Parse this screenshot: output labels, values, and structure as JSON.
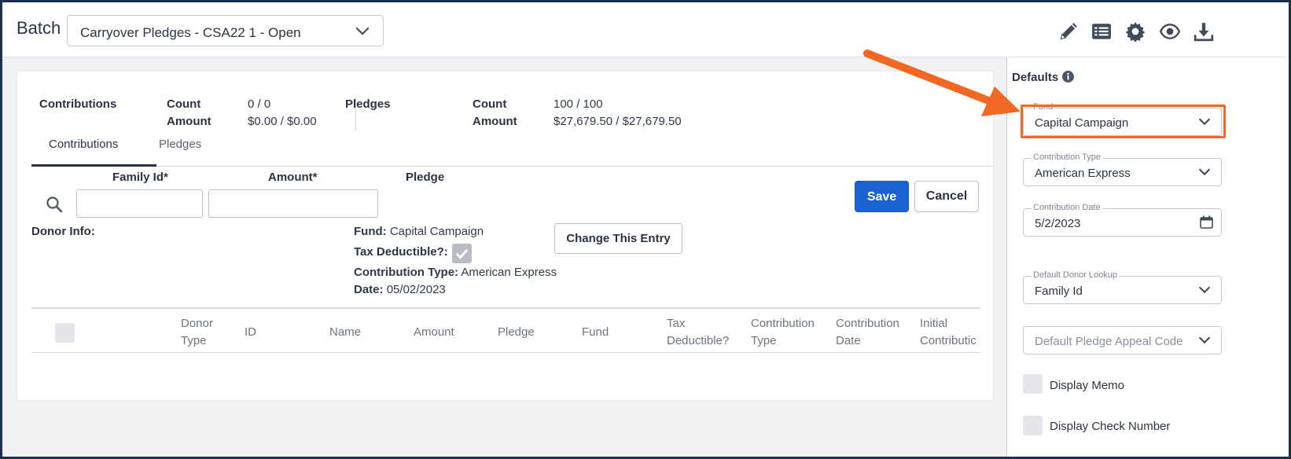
{
  "header": {
    "batch_label": "Batch",
    "batch_select_value": "Carryover Pledges - CSA22 1 - Open",
    "icons": [
      "edit-icon",
      "list-icon",
      "settings-icon",
      "eye-icon",
      "download-icon"
    ]
  },
  "summary": {
    "contributions_label": "Contributions",
    "count_label": "Count",
    "amount_label": "Amount",
    "contributions_count": "0 / 0",
    "contributions_amount": "$0.00 / $0.00",
    "pledges_label": "Pledges",
    "pledges_count": "100 / 100",
    "pledges_amount": "$27,679.50 / $27,679.50"
  },
  "tabs": [
    {
      "label": "Contributions",
      "active": true
    },
    {
      "label": "Pledges",
      "active": false
    }
  ],
  "entry": {
    "family_id_label": "Family Id*",
    "amount_label": "Amount*",
    "pledge_label": "Pledge",
    "save_label": "Save",
    "cancel_label": "Cancel",
    "donor_info_label": "Donor Info:",
    "fund_label": "Fund:",
    "fund_value": "Capital Campaign",
    "tax_deductible_label": "Tax Deductible?:",
    "contribution_type_label": "Contribution Type:",
    "contribution_type_value": "American Express",
    "date_label": "Date:",
    "date_value": "05/02/2023",
    "change_entry_label": "Change This Entry"
  },
  "grid": {
    "columns": [
      {
        "line1": "Donor",
        "line2": "Type"
      },
      {
        "line1": "ID",
        "line2": ""
      },
      {
        "line1": "Name",
        "line2": ""
      },
      {
        "line1": "Amount",
        "line2": ""
      },
      {
        "line1": "Pledge",
        "line2": ""
      },
      {
        "line1": "Fund",
        "line2": ""
      },
      {
        "line1": "Tax",
        "line2": "Deductible?"
      },
      {
        "line1": "Contribution",
        "line2": "Type"
      },
      {
        "line1": "Contribution",
        "line2": "Date"
      },
      {
        "line1": "Initial",
        "line2": "Contributic"
      }
    ]
  },
  "defaults": {
    "title": "Defaults",
    "fund_label": "Fund",
    "fund_value": "Capital Campaign",
    "contribution_type_label": "Contribution Type",
    "contribution_type_value": "American Express",
    "contribution_date_label": "Contribution Date",
    "contribution_date_value": "5/2/2023",
    "donor_lookup_label": "Default Donor Lookup",
    "donor_lookup_value": "Family Id",
    "pledge_appeal_placeholder": "Default Pledge Appeal Code",
    "display_memo_label": "Display Memo",
    "display_check_number_label": "Display Check Number"
  },
  "colors": {
    "primary": "#1a62d2",
    "annotation": "#f26722",
    "frame": "#1d2f4d"
  }
}
